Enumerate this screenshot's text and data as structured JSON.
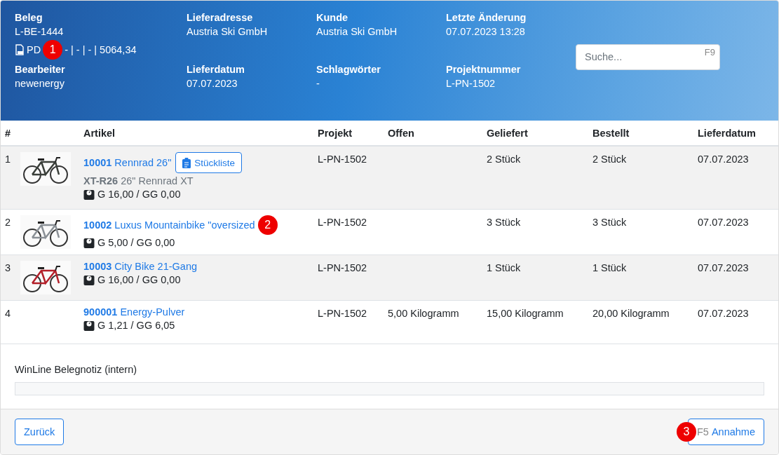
{
  "header": {
    "fields": [
      {
        "label": "Beleg",
        "values": [
          "L-BE-1444"
        ]
      },
      {
        "label": "Lieferadresse",
        "values": [
          "Austria Ski GmbH"
        ]
      },
      {
        "label": "Kunde",
        "values": [
          "Austria Ski GmbH"
        ]
      },
      {
        "label": "Letzte Änderung",
        "values": [
          "07.07.2023 13:28"
        ]
      }
    ],
    "doc_line": {
      "pdf": "PD",
      "marker": "1",
      "rest": "- | - | - | 5064,34"
    },
    "fields2": [
      {
        "label": "Bearbeiter",
        "values": [
          "newenergy"
        ]
      },
      {
        "label": "Lieferdatum",
        "values": [
          "07.07.2023"
        ]
      },
      {
        "label": "Schlagwörter",
        "values": [
          "-"
        ]
      },
      {
        "label": "Projektnummer",
        "values": [
          "L-PN-1502"
        ]
      }
    ],
    "search": {
      "placeholder": "Suche...",
      "shortcut": "F9"
    }
  },
  "table": {
    "columns": [
      "#",
      "Artikel",
      "Projekt",
      "Offen",
      "Geliefert",
      "Bestellt",
      "Lieferdatum"
    ],
    "rows": [
      {
        "num": "1",
        "article_no": "10001",
        "article_name": "Rennrad 26\"",
        "bom_button": "Stückliste",
        "sub_code": "XT-R26",
        "sub_name": "26\" Rennrad XT",
        "weight": "G 16,00 / GG 0,00",
        "project": "L-PN-1502",
        "delivered": "2 Stück",
        "ordered": "2 Stück",
        "date": "07.07.2023"
      },
      {
        "num": "2",
        "article_no": "10002",
        "article_name": "Luxus Mountainbike \"oversized",
        "marker": "2",
        "weight": "G 5,00 / GG 0,00",
        "project": "L-PN-1502",
        "delivered": "3 Stück",
        "ordered": "3 Stück",
        "date": "07.07.2023"
      },
      {
        "num": "3",
        "article_no": "10003",
        "article_name": "City Bike 21-Gang",
        "weight": "G 16,00 / GG 0,00",
        "project": "L-PN-1502",
        "delivered": "1 Stück",
        "ordered": "1 Stück",
        "date": "07.07.2023"
      },
      {
        "num": "4",
        "article_no": "900001",
        "article_name": "Energy-Pulver",
        "weight": "G 1,21 / GG 6,05",
        "project": "L-PN-1502",
        "open": "5,00 Kilogramm",
        "delivered": "15,00 Kilogramm",
        "ordered": "20,00 Kilogramm",
        "date": "07.07.2023"
      }
    ]
  },
  "note": {
    "label": "WinLine Belegnotiz (intern)"
  },
  "footer": {
    "back_button": "Zurück",
    "accept_marker": "3",
    "accept_shortcut": "F5",
    "accept_button": "Annahme"
  }
}
